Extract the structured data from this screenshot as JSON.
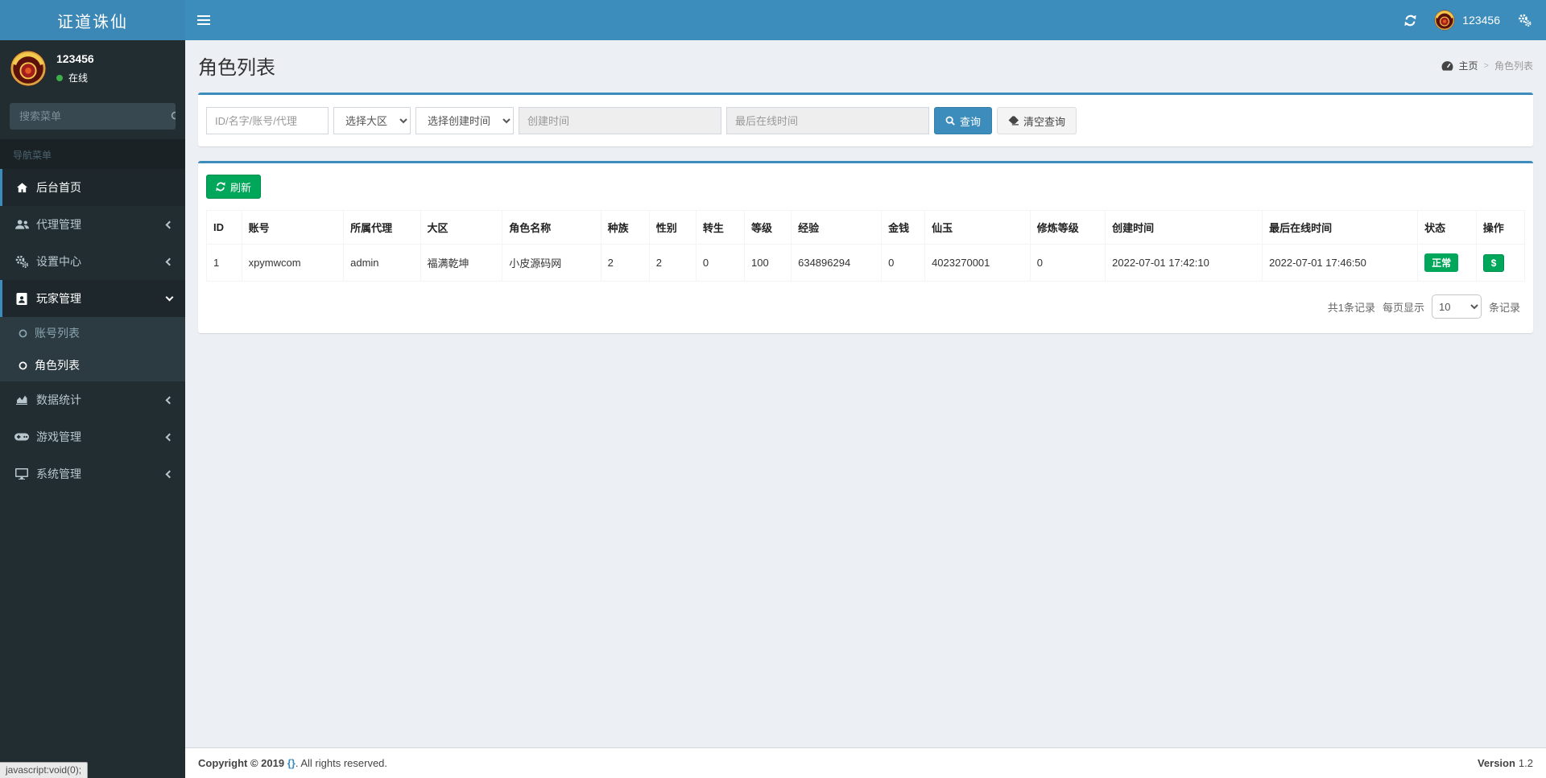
{
  "app": {
    "brand": "证道诛仙"
  },
  "colors": {
    "primary": "#3c8dbc",
    "success": "#00a65a",
    "sidebar_bg": "#222d32",
    "submenu_bg": "#2c3b41",
    "content_bg": "#ecf0f5"
  },
  "topbar": {
    "username": "123456"
  },
  "sidebar": {
    "user": {
      "name": "123456",
      "status": "在线"
    },
    "search_placeholder": "搜索菜单",
    "nav_header": "导航菜单",
    "items": [
      {
        "label": "后台首页",
        "icon": "home-icon",
        "active": true
      },
      {
        "label": "代理管理",
        "icon": "users-icon",
        "chevron": "left"
      },
      {
        "label": "设置中心",
        "icon": "gears-icon",
        "chevron": "left"
      },
      {
        "label": "玩家管理",
        "icon": "address-book-icon",
        "chevron": "down",
        "open": true,
        "children": [
          {
            "label": "账号列表",
            "icon": "circle-icon",
            "active": false
          },
          {
            "label": "角色列表",
            "icon": "circle-icon",
            "active": true
          }
        ]
      },
      {
        "label": "数据统计",
        "icon": "area-chart-icon",
        "chevron": "left"
      },
      {
        "label": "游戏管理",
        "icon": "gamepad-icon",
        "chevron": "left"
      },
      {
        "label": "系统管理",
        "icon": "desktop-icon",
        "chevron": "left"
      }
    ]
  },
  "page": {
    "title": "角色列表",
    "breadcrumb_home": "主页",
    "breadcrumb_current": "角色列表",
    "breadcrumb_icon": "dashboard-icon"
  },
  "filters": {
    "keyword_placeholder": "ID/名字/账号/代理",
    "zone_select": "选择大区",
    "time_type_select": "选择创建时间",
    "created_placeholder": "创建时间",
    "last_online_placeholder": "最后在线时间",
    "search_button": "查询",
    "clear_button": "清空查询"
  },
  "toolbar": {
    "refresh_button": "刷新"
  },
  "table": {
    "headers": [
      "ID",
      "账号",
      "所属代理",
      "大区",
      "角色名称",
      "种族",
      "性别",
      "转生",
      "等级",
      "经验",
      "金钱",
      "仙玉",
      "修炼等级",
      "创建时间",
      "最后在线时间",
      "状态",
      "操作"
    ],
    "rows": [
      {
        "id": "1",
        "account": "xpymwcom",
        "agent": "admin",
        "zone": "福满乾坤",
        "role_name": "小皮源码网",
        "race": "2",
        "gender": "2",
        "rebirth": "0",
        "level": "100",
        "exp": "634896294",
        "money": "0",
        "xianyu": "4023270001",
        "cultivation": "0",
        "created_at": "2022-07-01 17:42:10",
        "last_online": "2022-07-01 17:46:50",
        "status": "正常",
        "action": "$"
      }
    ]
  },
  "pagination": {
    "total_text": "共1条记录",
    "per_page_label": "每页显示",
    "per_page_value": "10",
    "per_page_suffix": "条记录"
  },
  "footer": {
    "copyright_bold": "Copyright © 2019",
    "copyright_link": "{}",
    "copyright_rest": ". All rights reserved.",
    "version_label": "Version",
    "version_value": "1.2"
  },
  "statusbar": {
    "text": "javascript:void(0);"
  },
  "icons": {
    "topbar": [
      "refresh-icon",
      "cogs-icon"
    ],
    "sidebar_search": "search-icon",
    "menu": [
      "home-icon",
      "users-icon",
      "gears-icon",
      "address-book-icon",
      "circle-icon",
      "area-chart-icon",
      "gamepad-icon",
      "desktop-icon"
    ],
    "breadcrumb": "dashboard-icon",
    "search_button_icon": "search-icon",
    "clear_button_icon": "eraser-icon",
    "refresh_button_icon": "refresh-icon",
    "action_icon": "dollar-icon"
  }
}
